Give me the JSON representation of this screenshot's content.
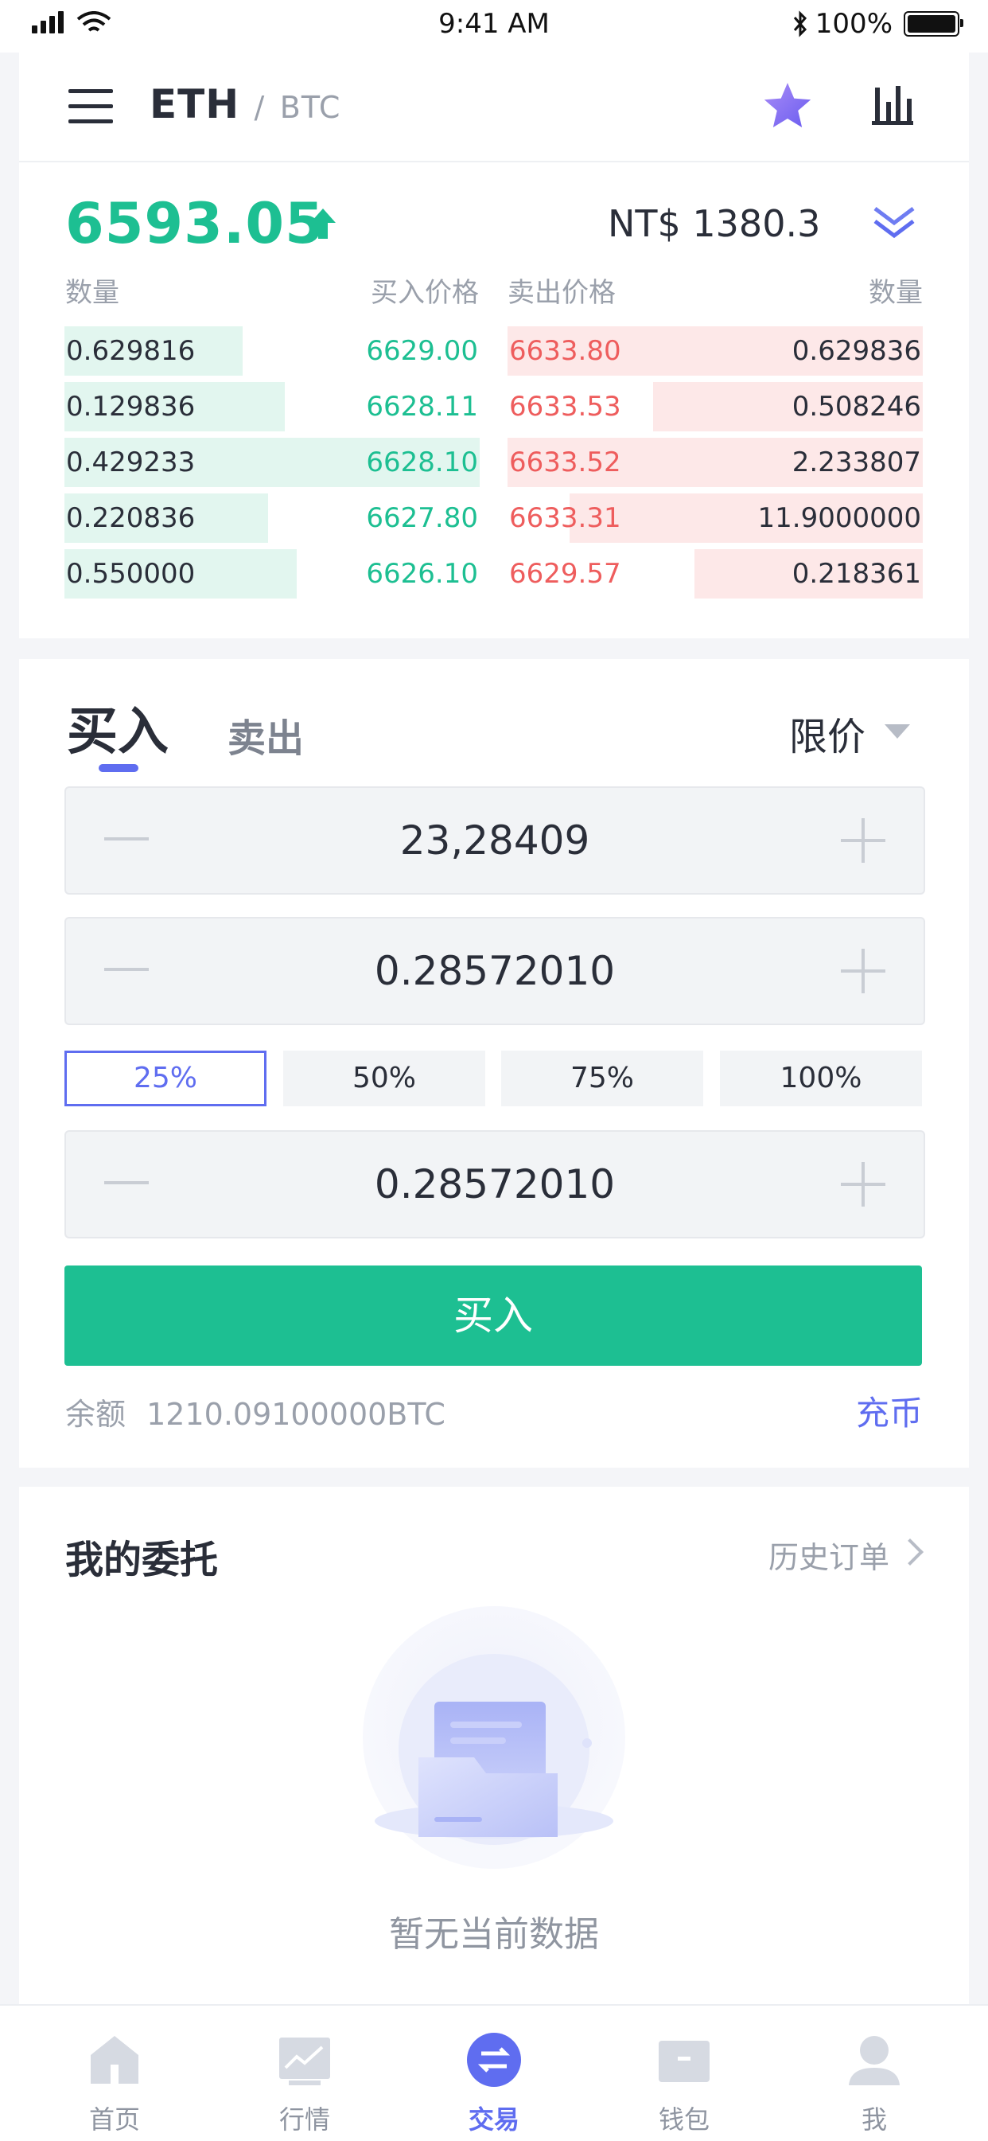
{
  "status_bar": {
    "time": "9:41 AM",
    "battery": "100%"
  },
  "header": {
    "base": "ETH",
    "separator": "/",
    "quote": "BTC"
  },
  "ticker": {
    "last_price": "6593.05",
    "fiat_price": "NT$ 1380.3"
  },
  "orderbook": {
    "headers": {
      "bid_qty": "数量",
      "bid_price": "买入价格",
      "ask_price": "卖出价格",
      "ask_qty": "数量"
    },
    "bids": [
      {
        "qty": "0.629816",
        "price": "6629.00",
        "depth": 0.43
      },
      {
        "qty": "0.129836",
        "price": "6628.11",
        "depth": 0.53
      },
      {
        "qty": "0.429233",
        "price": "6628.10",
        "depth": 1.0
      },
      {
        "qty": "0.220836",
        "price": "6627.80",
        "depth": 0.49
      },
      {
        "qty": "0.550000",
        "price": "6626.10",
        "depth": 0.56
      }
    ],
    "asks": [
      {
        "price": "6633.80",
        "qty": "0.629836",
        "depth": 1.0
      },
      {
        "price": "6633.53",
        "qty": "0.508246",
        "depth": 0.65
      },
      {
        "price": "6633.52",
        "qty": "2.233807",
        "depth": 1.0
      },
      {
        "price": "6633.31",
        "qty": "11.9000000",
        "depth": 0.85
      },
      {
        "price": "6629.57",
        "qty": "0.218361",
        "depth": 0.55
      }
    ]
  },
  "trade": {
    "tab_buy": "买入",
    "tab_sell": "卖出",
    "order_type": "限价",
    "price_value": "23,28409",
    "amount_value": "0.28572010",
    "total_value": "0.28572010",
    "percent_options": [
      "25%",
      "50%",
      "75%",
      "100%"
    ],
    "active_percent": "25%",
    "submit_label": "买入",
    "balance_label": "余额",
    "balance_value": "1210.09100000BTC",
    "deposit_label": "充币"
  },
  "orders": {
    "title": "我的委托",
    "history_label": "历史订单",
    "empty_text": "暂无当前数据"
  },
  "tabbar": {
    "items": [
      {
        "label": "首页",
        "icon": "home-icon"
      },
      {
        "label": "行情",
        "icon": "market-chart-icon"
      },
      {
        "label": "交易",
        "icon": "exchange-icon",
        "active": true
      },
      {
        "label": "钱包",
        "icon": "wallet-icon"
      },
      {
        "label": "我",
        "icon": "profile-icon"
      }
    ]
  },
  "colors": {
    "buy": "#1dbf92",
    "sell": "#ee5d5d",
    "accent": "#5f6df0"
  }
}
